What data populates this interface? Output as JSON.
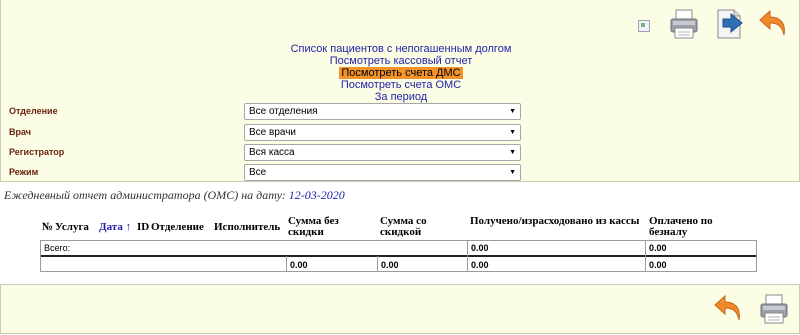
{
  "toolbar": {
    "broken_image_icon": "broken-image-icon",
    "print_icon": "printer-icon",
    "export_icon": "export-arrow-icon",
    "back_icon": "back-arrow-icon"
  },
  "menu": {
    "items": [
      {
        "label": "Список пациентов с непогашенным долгом",
        "active": false
      },
      {
        "label": "Посмотреть кассовый отчет",
        "active": false
      },
      {
        "label": "Посмотреть счета ДМС",
        "active": true
      },
      {
        "label": "Посмотреть счета ОМС",
        "active": false
      },
      {
        "label": "За период",
        "active": false
      }
    ]
  },
  "filters": {
    "department": {
      "label": "Отделение",
      "value": "Все отделения"
    },
    "doctor": {
      "label": "Врач",
      "value": "Все врачи"
    },
    "registrar": {
      "label": "Регистратор",
      "value": "Вся касса"
    },
    "mode": {
      "label": "Режим",
      "value": "Все"
    }
  },
  "report": {
    "caption": "Ежедневный отчет администратора (ОМС) на дату:",
    "date": "12-03-2020"
  },
  "table": {
    "headers": {
      "num": "№",
      "service": "Услуга",
      "date": "Дата ↑",
      "id": "ID",
      "department": "Отделение",
      "performer": "Исполнитель",
      "sum_no_discount": "Сумма без скидки",
      "sum_discount": "Сумма со скидкой",
      "received": "Получено/израсходовано из кассы",
      "paid_cashless": "Оплачено по безналу"
    },
    "total_row": {
      "label": "Всего:",
      "received": "0.00",
      "paid_cashless": "0.00"
    },
    "sum_row": {
      "sum_no_discount": "0.00",
      "sum_discount": "0.00",
      "received": "0.00",
      "paid_cashless": "0.00"
    }
  },
  "colors": {
    "panel_bg": "#fbfde5",
    "link": "#1f1fa8",
    "active_menu_bg": "#f5932b",
    "filter_label": "#6a1f0e"
  }
}
